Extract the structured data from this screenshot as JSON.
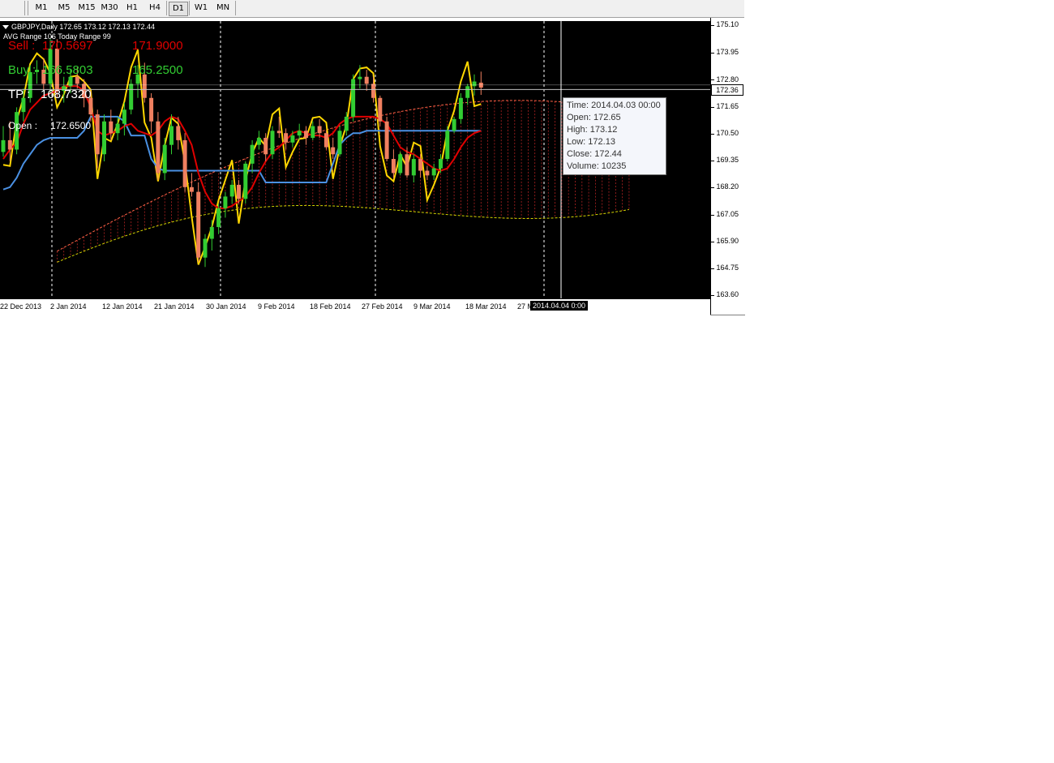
{
  "toolbar": {
    "timeframes": [
      "M1",
      "M5",
      "M15",
      "M30",
      "H1",
      "H4",
      "D1",
      "W1",
      "MN"
    ]
  },
  "chart": {
    "header": {
      "symbol_line": "GBPJPY,Daily  172.65 173.12 172.13 172.44",
      "avg_range_line": "AVG Range 106   Today Range 99"
    },
    "panel": {
      "sell_label": "Sell :",
      "sell_value": "170.5697",
      "sell_target": "171.9000",
      "buy_label": "Buy :",
      "buy_value": "166.5803",
      "buy_target": "165.2500",
      "tp_label": "TP :",
      "tp_value": "168.7320",
      "open_label": "Open  :",
      "open_value": "172.6500"
    },
    "price_axis": [
      "175.10",
      "173.95",
      "172.80",
      "171.65",
      "170.50",
      "169.35",
      "168.20",
      "167.05",
      "165.90",
      "164.75",
      "163.60"
    ],
    "current_price": "172.36",
    "date_axis": [
      "22 Dec 2013",
      "2 Jan 2014",
      "12 Jan 2014",
      "21 Jan 2014",
      "30 Jan 2014",
      "9 Feb 2014",
      "18 Feb 2014",
      "27 Feb 2014",
      "9 Mar 2014",
      "18 Mar 2014",
      "27 Mar 2014"
    ],
    "crosshair_date": "2014.04.04 0:00",
    "tooltip": {
      "time": "Time: 2014.04.03 00:00",
      "open": "Open: 172.65",
      "high": "High: 173.12",
      "low": "Low:  172.13",
      "close": "Close: 172.44",
      "volume": "Volume: 10235"
    },
    "colors": {
      "background": "#000000",
      "bull_candle": "#32cd32",
      "bear_candle": "#f08060",
      "tenkan": "#e00000",
      "kijun": "#4a90e2",
      "chikou": "#ffd700",
      "sell_text": "#e00000",
      "buy_text": "#32cd32"
    },
    "candles": [
      [
        169.7,
        170.8,
        169.5,
        170.2
      ],
      [
        170.2,
        171.0,
        169.3,
        169.8
      ],
      [
        169.8,
        171.6,
        169.6,
        171.4
      ],
      [
        171.4,
        172.4,
        171.0,
        172.0
      ],
      [
        172.0,
        173.4,
        171.8,
        173.1
      ],
      [
        173.1,
        173.6,
        172.6,
        173.2
      ],
      [
        173.2,
        173.7,
        172.3,
        172.6
      ],
      [
        172.6,
        174.5,
        172.2,
        174.1
      ],
      [
        174.1,
        174.5,
        172.0,
        172.3
      ],
      [
        172.3,
        172.9,
        171.8,
        172.5
      ],
      [
        172.5,
        173.2,
        172.2,
        172.9
      ],
      [
        172.9,
        173.3,
        172.4,
        172.6
      ],
      [
        172.6,
        172.8,
        171.6,
        172.0
      ],
      [
        172.0,
        172.3,
        171.0,
        171.3
      ],
      [
        171.3,
        171.5,
        169.0,
        169.6
      ],
      [
        169.6,
        171.3,
        169.3,
        171.0
      ],
      [
        171.0,
        171.5,
        170.2,
        170.5
      ],
      [
        170.5,
        171.2,
        170.2,
        170.9
      ],
      [
        170.9,
        171.8,
        170.4,
        171.5
      ],
      [
        171.5,
        172.8,
        171.3,
        172.6
      ],
      [
        172.6,
        173.4,
        172.0,
        173.0
      ],
      [
        173.0,
        173.5,
        171.8,
        172.0
      ],
      [
        172.0,
        172.2,
        170.5,
        171.0
      ],
      [
        171.0,
        171.4,
        168.5,
        168.8
      ],
      [
        168.8,
        170.3,
        168.5,
        170.0
      ],
      [
        170.0,
        171.3,
        169.6,
        170.8
      ],
      [
        170.8,
        171.2,
        169.8,
        170.2
      ],
      [
        170.2,
        170.5,
        168.0,
        168.2
      ],
      [
        168.2,
        168.8,
        167.8,
        168.0
      ],
      [
        168.0,
        168.4,
        165.0,
        165.2
      ],
      [
        165.2,
        166.2,
        164.8,
        166.0
      ],
      [
        166.0,
        166.8,
        165.5,
        166.5
      ],
      [
        166.5,
        167.5,
        166.2,
        167.3
      ],
      [
        167.3,
        168.0,
        166.9,
        167.8
      ],
      [
        167.8,
        168.5,
        167.5,
        168.3
      ],
      [
        168.3,
        168.5,
        167.5,
        167.7
      ],
      [
        167.7,
        169.3,
        167.5,
        169.2
      ],
      [
        169.2,
        170.2,
        168.8,
        170.0
      ],
      [
        170.0,
        170.6,
        169.8,
        170.3
      ],
      [
        170.3,
        170.5,
        169.3,
        169.6
      ],
      [
        169.6,
        170.8,
        169.4,
        170.6
      ],
      [
        170.6,
        171.2,
        170.3,
        170.5
      ],
      [
        170.5,
        170.7,
        169.8,
        170.1
      ],
      [
        170.1,
        170.6,
        169.9,
        170.4
      ],
      [
        170.4,
        170.9,
        170.2,
        170.6
      ],
      [
        170.6,
        170.8,
        170.0,
        170.3
      ],
      [
        170.3,
        171.0,
        170.2,
        170.8
      ],
      [
        170.8,
        171.1,
        170.3,
        170.5
      ],
      [
        170.5,
        170.6,
        169.8,
        169.9
      ],
      [
        169.9,
        170.3,
        169.4,
        169.6
      ],
      [
        169.6,
        170.8,
        169.5,
        170.6
      ],
      [
        170.6,
        171.4,
        170.4,
        171.2
      ],
      [
        171.2,
        173.0,
        171.0,
        172.8
      ],
      [
        172.8,
        173.4,
        172.4,
        172.9
      ],
      [
        172.9,
        173.2,
        172.3,
        172.6
      ],
      [
        172.6,
        172.9,
        171.8,
        172.0
      ],
      [
        172.0,
        172.1,
        170.8,
        171.0
      ],
      [
        171.0,
        171.2,
        169.3,
        169.4
      ],
      [
        169.4,
        169.8,
        168.6,
        168.8
      ],
      [
        168.8,
        169.7,
        168.7,
        169.6
      ],
      [
        169.6,
        169.9,
        168.6,
        168.7
      ],
      [
        168.7,
        169.6,
        168.4,
        169.4
      ],
      [
        169.4,
        169.6,
        168.6,
        168.9
      ],
      [
        168.9,
        169.1,
        168.5,
        168.7
      ],
      [
        168.7,
        169.2,
        168.5,
        169.0
      ],
      [
        169.0,
        169.6,
        168.8,
        169.4
      ],
      [
        169.4,
        170.8,
        169.3,
        170.6
      ],
      [
        170.6,
        171.2,
        170.5,
        171.1
      ],
      [
        171.1,
        172.2,
        170.9,
        172.0
      ],
      [
        172.0,
        172.6,
        171.7,
        172.5
      ],
      [
        172.5,
        173.0,
        172.1,
        172.7
      ],
      [
        172.65,
        173.12,
        172.13,
        172.44
      ]
    ],
    "tenkan": [
      169.4,
      169.8,
      170.1,
      170.9,
      171.5,
      171.8,
      172.1,
      172.2,
      172.3,
      172.5,
      172.5,
      172.5,
      172.3,
      171.6,
      170.6,
      170.4,
      170.5,
      170.6,
      170.8,
      170.9,
      170.6,
      170.5,
      170.4,
      170.6,
      171.0,
      171.2,
      171.1,
      170.6,
      170.0,
      168.8,
      168.0,
      167.5,
      167.3,
      167.3,
      167.4,
      167.6,
      167.8,
      168.2,
      168.8,
      169.3,
      169.7,
      169.9,
      170.2,
      170.5,
      170.6,
      170.5,
      170.4,
      170.4,
      170.3,
      170.5,
      170.9,
      171.1,
      171.2,
      171.2,
      171.2,
      171.2,
      171.1,
      170.9,
      170.4,
      169.9,
      169.7,
      169.6,
      169.4,
      169.2,
      169.0,
      168.9,
      169.0,
      169.4,
      169.9,
      170.3,
      170.5,
      170.6
    ],
    "kijun": [
      168.1,
      168.2,
      168.6,
      169.2,
      169.6,
      170.0,
      170.2,
      170.3,
      170.3,
      170.3,
      170.3,
      170.3,
      170.6,
      171.2,
      171.2,
      171.2,
      171.2,
      171.2,
      171.0,
      170.4,
      170.4,
      170.4,
      169.4,
      169.0,
      168.9,
      168.9,
      168.9,
      168.9,
      168.9,
      168.9,
      168.9,
      168.9,
      168.9,
      168.9,
      168.9,
      168.9,
      168.9,
      168.9,
      168.9,
      168.4,
      168.4,
      168.4,
      168.4,
      168.4,
      168.4,
      168.4,
      168.4,
      168.4,
      168.4,
      169.2,
      170.0,
      170.3,
      170.5,
      170.5,
      170.6,
      170.6,
      170.6,
      170.6,
      170.6,
      170.6,
      170.6,
      170.6,
      170.6,
      170.6,
      170.6,
      170.6,
      170.6,
      170.6,
      170.6,
      170.6,
      170.6,
      170.6
    ]
  }
}
